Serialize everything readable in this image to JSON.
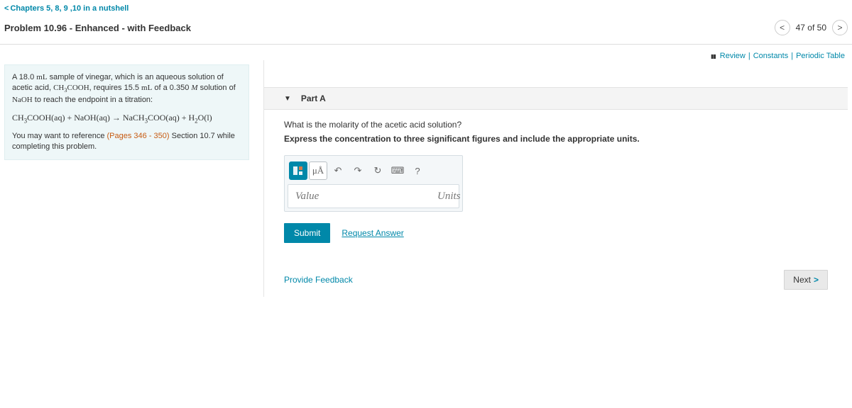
{
  "breadcrumb": {
    "label": "Chapters 5, 8, 9 ,10 in a nutshell"
  },
  "problem_title": "Problem 10.96 - Enhanced - with Feedback",
  "pager": {
    "text": "47 of 50"
  },
  "review_links": {
    "review": "Review",
    "constants": "Constants",
    "periodic": "Periodic Table"
  },
  "question_box": {
    "intro_1": "A 18.0 ",
    "intro_unit1": "mL",
    "intro_2": " sample of vinegar, which is an aqueous solution of acetic acid, ",
    "formula1": "CH3COOH",
    "intro_3": ", requires 15.5 ",
    "intro_unit2": "mL",
    "intro_4": " of a 0.350 ",
    "intro_unit3": "M",
    "intro_5": " solution of ",
    "formula2": "NaOH",
    "intro_6": " to reach the endpoint in a titration:",
    "equation": "CH3COOH(aq) + NaOH(aq) → NaCH3COO(aq) + H2O(l)",
    "ref_1": "You may want to reference ",
    "ref_link": "(Pages 346 - 350)",
    "ref_2": " Section 10.7 while completing this problem."
  },
  "part": {
    "header": "Part A",
    "question": "What is the molarity of the acetic acid solution?",
    "instruction": "Express the concentration to three significant figures and include the appropriate units.",
    "toolbar": {
      "special": "μÅ",
      "undo": "↶",
      "redo": "↷",
      "reset": "↻",
      "keyboard": "⌨",
      "help": "?"
    },
    "inputs": {
      "value_placeholder": "Value",
      "units_placeholder": "Units"
    },
    "submit": "Submit",
    "request_answer": "Request Answer"
  },
  "footer": {
    "provide_feedback": "Provide Feedback",
    "next": "Next"
  }
}
